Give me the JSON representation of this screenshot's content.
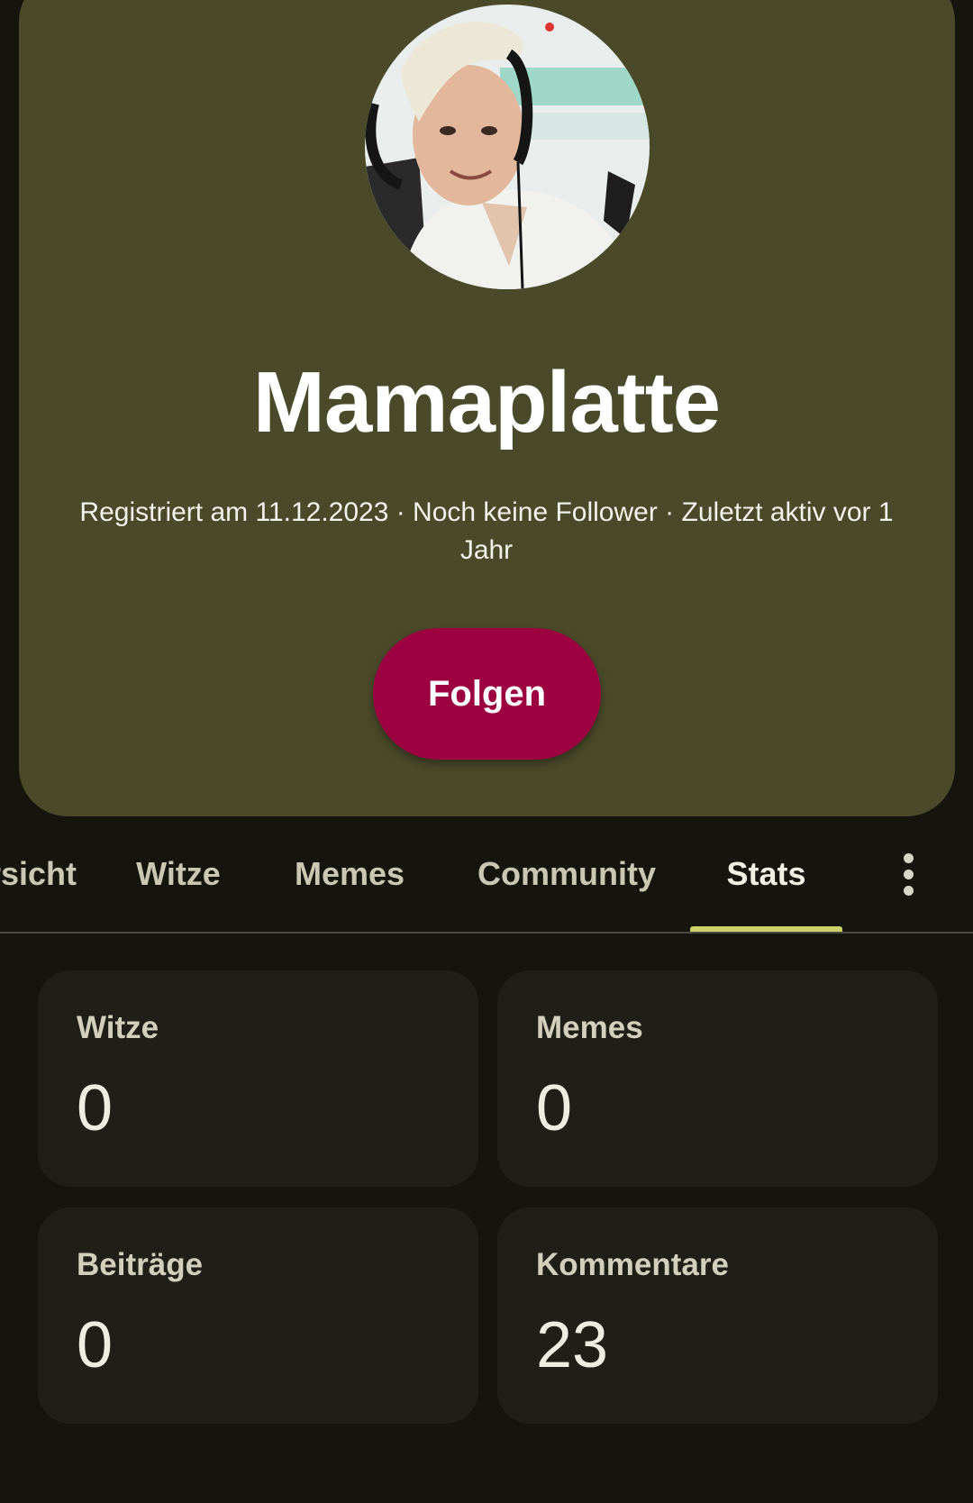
{
  "profile": {
    "name": "Mamaplatte",
    "meta": "Registriert am 11.12.2023 · Noch keine Follower · Zuletzt aktiv vor 1 Jahr",
    "follow_label": "Folgen",
    "avatar_alt": "avatar"
  },
  "tabs": [
    {
      "label": "Übersicht",
      "active": false
    },
    {
      "label": "Witze",
      "active": false
    },
    {
      "label": "Memes",
      "active": false
    },
    {
      "label": "Community",
      "active": false
    },
    {
      "label": "Stats",
      "active": true
    }
  ],
  "more_icon": "more-vertical-icon",
  "stats": [
    {
      "label": "Witze",
      "value": "0"
    },
    {
      "label": "Memes",
      "value": "0"
    },
    {
      "label": "Beiträge",
      "value": "0"
    },
    {
      "label": "Kommentare",
      "value": "23"
    }
  ],
  "colors": {
    "background": "#15150e",
    "card": "#4a4a2a",
    "follow_button": "#9c0040",
    "tab_indicator": "#cdd26b",
    "stat_card": "#1f1f18"
  }
}
